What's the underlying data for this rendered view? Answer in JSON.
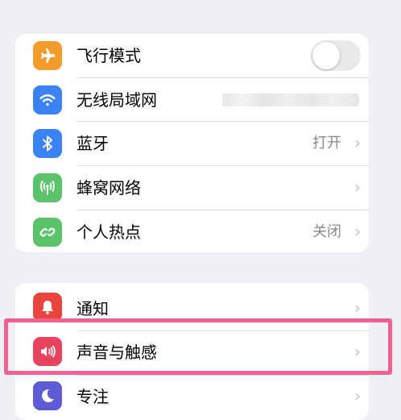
{
  "network_group": {
    "airplane": {
      "label": "飞行模式",
      "icon": "airplane-icon",
      "color": "#f39c2c",
      "toggle_on": false
    },
    "wifi": {
      "label": "无线局域网",
      "icon": "wifi-icon",
      "color": "#3a82f6"
    },
    "bluetooth": {
      "label": "蓝牙",
      "icon": "bluetooth-icon",
      "color": "#3a82f6",
      "value": "打开",
      "chevron": "›"
    },
    "cellular": {
      "label": "蜂窝网络",
      "icon": "antenna-icon",
      "color": "#5ac46a",
      "chevron": "›"
    },
    "hotspot": {
      "label": "个人热点",
      "icon": "hotspot-link-icon",
      "color": "#5ac46a",
      "value": "关闭",
      "chevron": "›"
    }
  },
  "notification_group": {
    "notifications": {
      "label": "通知",
      "icon": "bell-icon",
      "color": "#e9453c",
      "chevron": "›"
    },
    "sounds": {
      "label": "声音与触感",
      "icon": "speaker-icon",
      "color": "#e9425c",
      "chevron": "›"
    },
    "focus": {
      "label": "专注",
      "icon": "moon-icon",
      "color": "#5d5bd6",
      "chevron": "›"
    }
  },
  "highlight_color": "#f0628f"
}
